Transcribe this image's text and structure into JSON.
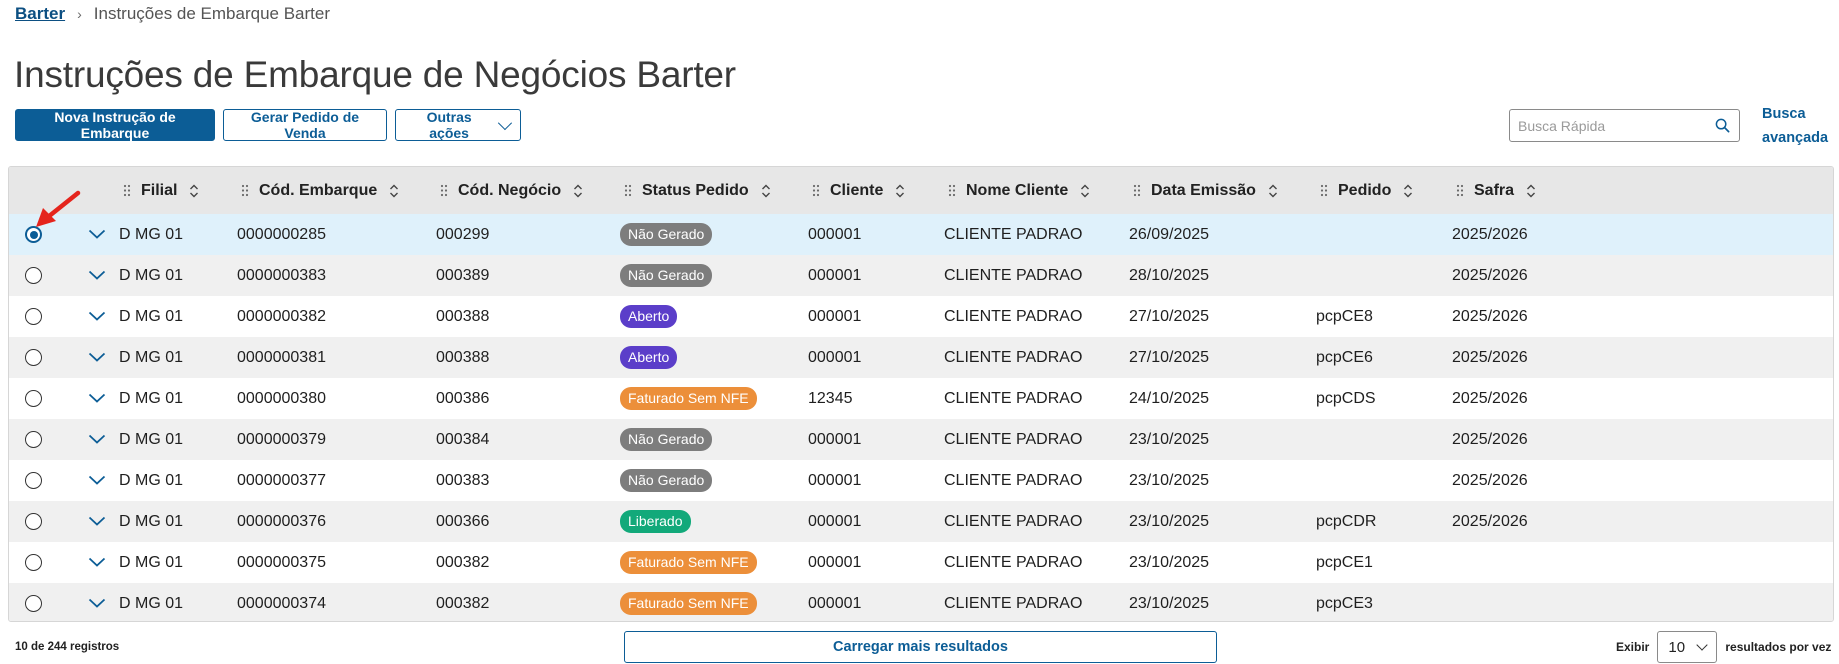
{
  "breadcrumb": {
    "root": "Barter",
    "separator": "›",
    "current": "Instruções de Embarque Barter"
  },
  "page_title": "Instruções de Embarque de Negócios Barter",
  "toolbar": {
    "new_label": "Nova Instrução de Embarque",
    "gerar_label": "Gerar Pedido de Venda",
    "outras_label": "Outras ações"
  },
  "search": {
    "placeholder": "Busca Rápida",
    "advanced_label": "Busca avançada"
  },
  "colors": {
    "primary": "#0c5d96",
    "status_nao_gerado": "#7d7d7d",
    "status_aberto": "#5b3ec9",
    "status_faturado": "#ec8f3a",
    "status_liberado": "#12a97a",
    "selected_row": "#dff1fb",
    "annotation_arrow": "#e5241c"
  },
  "table": {
    "headers": {
      "filial": "Filial",
      "cod_embarque": "Cód. Embarque",
      "cod_negocio": "Cód. Negócio",
      "status": "Status Pedido",
      "cliente": "Cliente",
      "nome_cliente": "Nome Cliente",
      "data_emissao": "Data Emissão",
      "pedido": "Pedido",
      "safra": "Safra"
    },
    "rows": [
      {
        "selected": true,
        "filial": "D MG 01",
        "cod_embarque": "0000000285",
        "cod_negocio": "000299",
        "status": "Não Gerado",
        "status_kind": "nao_gerado",
        "cliente": "000001",
        "nome_cliente": "CLIENTE PADRAO",
        "data_emissao": "26/09/2025",
        "pedido": "",
        "safra": "2025/2026"
      },
      {
        "selected": false,
        "filial": "D MG 01",
        "cod_embarque": "0000000383",
        "cod_negocio": "000389",
        "status": "Não Gerado",
        "status_kind": "nao_gerado",
        "cliente": "000001",
        "nome_cliente": "CLIENTE PADRAO",
        "data_emissao": "28/10/2025",
        "pedido": "",
        "safra": "2025/2026"
      },
      {
        "selected": false,
        "filial": "D MG 01",
        "cod_embarque": "0000000382",
        "cod_negocio": "000388",
        "status": "Aberto",
        "status_kind": "aberto",
        "cliente": "000001",
        "nome_cliente": "CLIENTE PADRAO",
        "data_emissao": "27/10/2025",
        "pedido": "pcpCE8",
        "safra": "2025/2026"
      },
      {
        "selected": false,
        "filial": "D MG 01",
        "cod_embarque": "0000000381",
        "cod_negocio": "000388",
        "status": "Aberto",
        "status_kind": "aberto",
        "cliente": "000001",
        "nome_cliente": "CLIENTE PADRAO",
        "data_emissao": "27/10/2025",
        "pedido": "pcpCE6",
        "safra": "2025/2026"
      },
      {
        "selected": false,
        "filial": "D MG 01",
        "cod_embarque": "0000000380",
        "cod_negocio": "000386",
        "status": "Faturado Sem NFE",
        "status_kind": "faturado",
        "cliente": "12345",
        "nome_cliente": "CLIENTE PADRAO",
        "data_emissao": "24/10/2025",
        "pedido": "pcpCDS",
        "safra": "2025/2026"
      },
      {
        "selected": false,
        "filial": "D MG 01",
        "cod_embarque": "0000000379",
        "cod_negocio": "000384",
        "status": "Não Gerado",
        "status_kind": "nao_gerado",
        "cliente": "000001",
        "nome_cliente": "CLIENTE PADRAO",
        "data_emissao": "23/10/2025",
        "pedido": "",
        "safra": "2025/2026"
      },
      {
        "selected": false,
        "filial": "D MG 01",
        "cod_embarque": "0000000377",
        "cod_negocio": "000383",
        "status": "Não Gerado",
        "status_kind": "nao_gerado",
        "cliente": "000001",
        "nome_cliente": "CLIENTE PADRAO",
        "data_emissao": "23/10/2025",
        "pedido": "",
        "safra": "2025/2026"
      },
      {
        "selected": false,
        "filial": "D MG 01",
        "cod_embarque": "0000000376",
        "cod_negocio": "000366",
        "status": "Liberado",
        "status_kind": "liberado",
        "cliente": "000001",
        "nome_cliente": "CLIENTE PADRAO",
        "data_emissao": "23/10/2025",
        "pedido": "pcpCDR",
        "safra": "2025/2026"
      },
      {
        "selected": false,
        "filial": "D MG 01",
        "cod_embarque": "0000000375",
        "cod_negocio": "000382",
        "status": "Faturado Sem NFE",
        "status_kind": "faturado",
        "cliente": "000001",
        "nome_cliente": "CLIENTE PADRAO",
        "data_emissao": "23/10/2025",
        "pedido": "pcpCE1",
        "safra": ""
      },
      {
        "selected": false,
        "filial": "D MG 01",
        "cod_embarque": "0000000374",
        "cod_negocio": "000382",
        "status": "Faturado Sem NFE",
        "status_kind": "faturado",
        "cliente": "000001",
        "nome_cliente": "CLIENTE PADRAO",
        "data_emissao": "23/10/2025",
        "pedido": "pcpCE3",
        "safra": ""
      }
    ]
  },
  "footer": {
    "count": "10 de 244 registros",
    "load_more": "Carregar mais resultados",
    "show_label": "Exibir",
    "per_page_value": "10",
    "per_page_suffix": "resultados por vez"
  }
}
